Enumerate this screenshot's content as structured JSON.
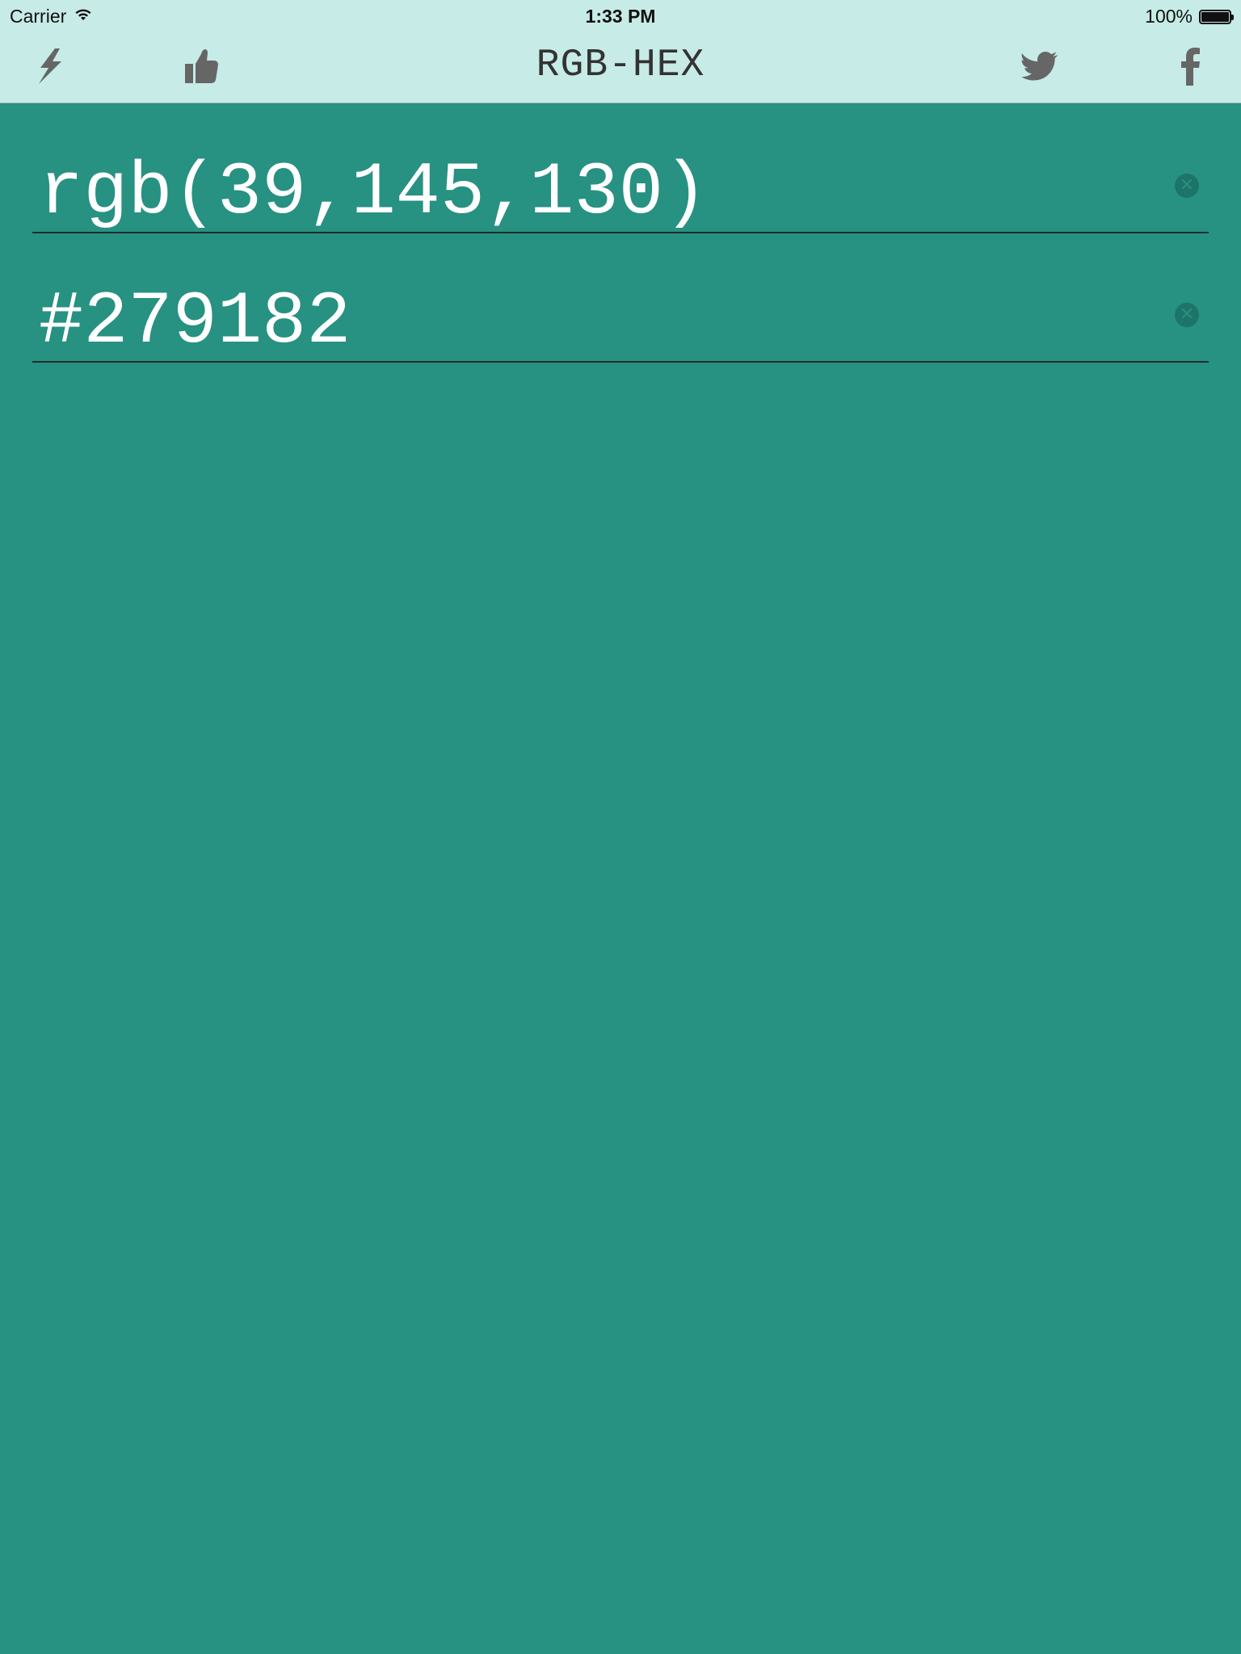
{
  "status_bar": {
    "carrier": "Carrier",
    "time": "1:33 PM",
    "battery_percent": "100%",
    "battery_level": 1.0
  },
  "nav_bar": {
    "title": "RGB-HEX",
    "left_icons": [
      "lightning-icon",
      "thumbs-up-icon"
    ],
    "right_icons": [
      "twitter-icon",
      "facebook-icon"
    ]
  },
  "fields": {
    "rgb_value": "rgb(39,145,130)",
    "hex_value": "#279182"
  },
  "colors": {
    "background": "#279182",
    "bar": "#c7ebe6",
    "icon": "#666666",
    "text": "#ffffff"
  }
}
